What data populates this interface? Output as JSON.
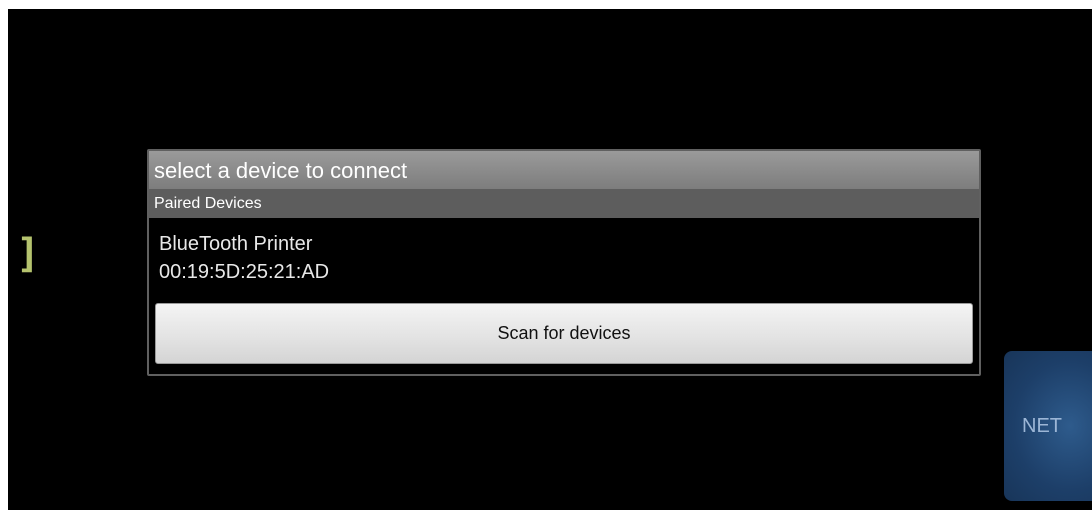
{
  "background": {
    "bracket_text": "]",
    "net_button_label": "NET"
  },
  "dialog": {
    "title": "select a device to connect",
    "section_label": "Paired Devices",
    "devices": [
      {
        "name": "BlueTooth Printer",
        "address": "00:19:5D:25:21:AD"
      }
    ],
    "scan_button_label": "Scan for devices"
  },
  "colors": {
    "screen_background": "#000000",
    "dialog_header": "#8c8c8c",
    "section_header": "#5d5d5d",
    "bracket_accent": "#b5c36e",
    "net_button": "#1d3f69"
  }
}
